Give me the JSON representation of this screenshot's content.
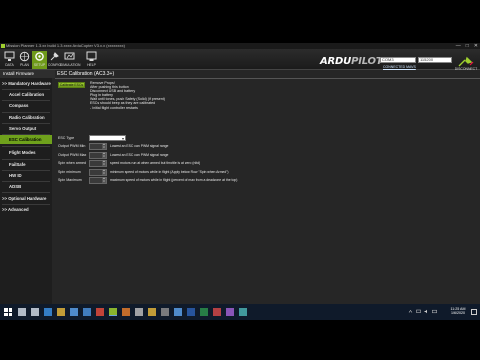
{
  "window": {
    "title": "Mission Planner 1.3.xx build 1.3.xxxx ArduCopter V3.x.x (xxxxxxxx)",
    "controls": [
      "—",
      "□",
      "✕"
    ]
  },
  "toolbar": {
    "buttons": [
      {
        "label": "DATA",
        "icon": "monitor-icon"
      },
      {
        "label": "PLAN",
        "icon": "globe-icon"
      },
      {
        "label": "SETUP",
        "icon": "setup-icon"
      },
      {
        "label": "CONFIG",
        "icon": "config-icon"
      },
      {
        "label": "SIMULATION",
        "icon": "simulation-icon"
      },
      {
        "label": "HELP",
        "icon": "help-icon"
      }
    ],
    "logo_main": "ARDU",
    "logo_accent": "PILOT",
    "port_value": "COM3",
    "baud_value": "115200",
    "stats_link": "CONNECTED MAVS",
    "connect_label": "DISCONNECT",
    "colors": {
      "accent": "#6fa11c",
      "connect": "#9fcf2f"
    }
  },
  "breadcrumb": "Install Firmware",
  "sidebar": {
    "items": [
      {
        "label": ">> Mandatory Hardware",
        "type": "cat"
      },
      {
        "label": "Accel Calibration",
        "type": "sub"
      },
      {
        "label": "Compass",
        "type": "sub"
      },
      {
        "label": "Radio Calibration",
        "type": "sub"
      },
      {
        "label": "Servo Output",
        "type": "sub"
      },
      {
        "label": "ESC Calibration",
        "type": "sub",
        "active": true
      },
      {
        "label": "Flight Modes",
        "type": "sub"
      },
      {
        "label": "FailSafe",
        "type": "sub"
      },
      {
        "label": "HW ID",
        "type": "sub"
      },
      {
        "label": "ADSB",
        "type": "sub"
      },
      {
        "label": ">> Optional Hardware",
        "type": "cat"
      },
      {
        "label": ">> Advanced",
        "type": "cat"
      }
    ]
  },
  "esc": {
    "title": "ESC Calibration (AC3.3+)",
    "calibrate_label": "Calibrate ESCs",
    "instructions": [
      "Remove Props!",
      "After pushing this button",
      "Disconnect USB and battery",
      "Plug in battery",
      "Wait until tones, push Safety (Solid) (if present)",
      "ESCs should beep as they are calibrated",
      "- Initial flight controller restarts"
    ],
    "esc_type_label": "ESC Type",
    "params": [
      {
        "label": "Output PWM Min",
        "desc": "Lowest an ESC can PWM signal range"
      },
      {
        "label": "Output PWM Max",
        "desc": "Lowest an ESC can PWM signal range"
      },
      {
        "label": "Spin when armed",
        "desc": "speed motors run at when armed but throttle is at zero (nltd)"
      },
      {
        "label": "Spin minimum",
        "desc": "minimum speed of motors while in flight (Apply below Row \"Spin when Armed\")"
      },
      {
        "label": "Spin Maximum",
        "desc": "maximum speed of motors while in flight (percent of max from a deadzone at the top)"
      }
    ]
  },
  "taskbar": {
    "time": "11:25 AM",
    "date": "1/6/2020",
    "apps": [
      "search-icon",
      "taskview-icon",
      "edge-icon",
      "explorer-icon",
      "store-icon",
      "mail-icon",
      "chrome-icon",
      "mission-planner-icon",
      "firefox-icon",
      "settings-icon",
      "folder-icon",
      "terminal-icon",
      "app-icon",
      "word-icon",
      "excel-icon",
      "app-icon",
      "app-icon",
      "app-icon"
    ],
    "colors": {
      "bg": "#0f1a2a"
    }
  }
}
